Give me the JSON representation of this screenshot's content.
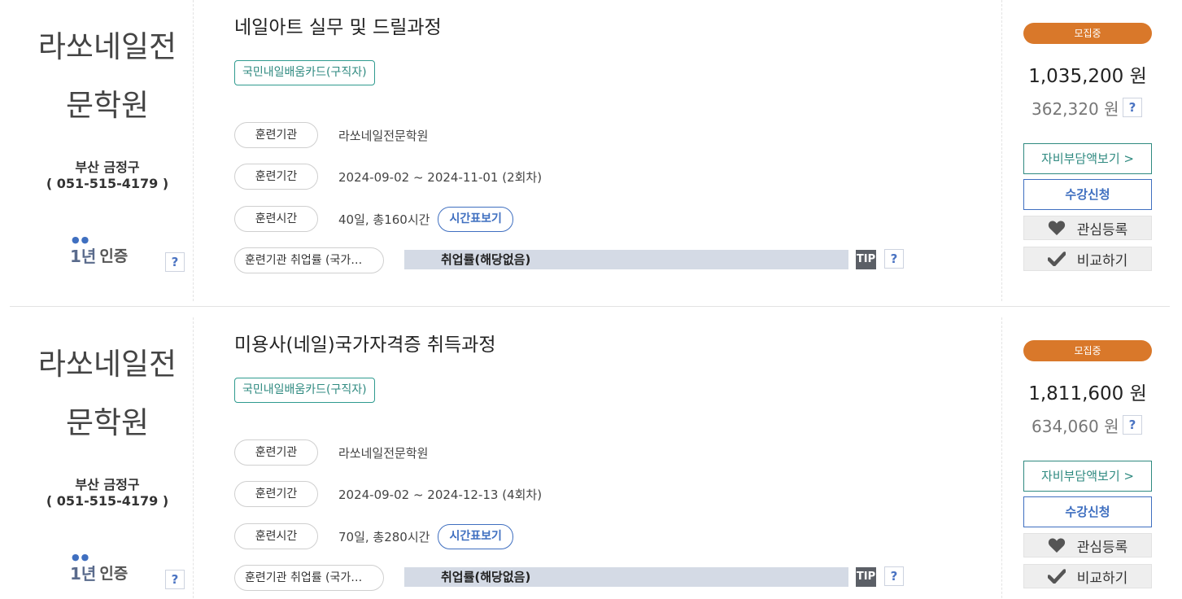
{
  "courses": [
    {
      "institution_name_line1": "라쏘네일전",
      "institution_name_line2": "문학원",
      "location": "부산 금정구",
      "phone": "( 051-515-4179 )",
      "cert_number": "1년",
      "cert_label": "인증",
      "cert_help": "?",
      "title": "네일아트 실무 및 드릴과정",
      "card_tag": "국민내일배움카드(구직자)",
      "institution_label": "훈련기관",
      "institution_value": "라쏘네일전문학원",
      "period_label": "훈련기간",
      "period_value": "2024-09-02 ~ 2024-11-01 (2회차)",
      "hours_label": "훈련시간",
      "hours_value": "40일, 총160시간",
      "timetable_button": "시간표보기",
      "employment_label": "훈련기관 취업률 (국가…",
      "employment_value": "취업률(해당없음)",
      "tip_label": "TIP",
      "employment_help": "?",
      "status": "모집중",
      "price": "1,035,200 원",
      "self_pay": "362,320 원",
      "self_pay_help": "?",
      "self_pay_button": "자비부담액보기 >",
      "apply_button": "수강신청",
      "favorite_button": "관심등록",
      "compare_button": "비교하기"
    },
    {
      "institution_name_line1": "라쏘네일전",
      "institution_name_line2": "문학원",
      "location": "부산 금정구",
      "phone": "( 051-515-4179 )",
      "cert_number": "1년",
      "cert_label": "인증",
      "cert_help": "?",
      "title": "미용사(네일)국가자격증 취득과정",
      "card_tag": "국민내일배움카드(구직자)",
      "institution_label": "훈련기관",
      "institution_value": "라쏘네일전문학원",
      "period_label": "훈련기간",
      "period_value": "2024-09-02 ~ 2024-12-13 (4회차)",
      "hours_label": "훈련시간",
      "hours_value": "70일, 총280시간",
      "timetable_button": "시간표보기",
      "employment_label": "훈련기관 취업률 (국가…",
      "employment_value": "취업률(해당없음)",
      "tip_label": "TIP",
      "employment_help": "?",
      "status": "모집중",
      "price": "1,811,600 원",
      "self_pay": "634,060 원",
      "self_pay_help": "?",
      "self_pay_button": "자비부담액보기 >",
      "apply_button": "수강신청",
      "favorite_button": "관심등록",
      "compare_button": "비교하기"
    }
  ],
  "icons": {
    "cert_dots": "certification-dots-icon",
    "favorite": "heart-icon",
    "compare": "checkmark-icon"
  },
  "colors": {
    "status_badge": "#d9782a",
    "teal_accent": "#2f8a80",
    "blue_accent": "#3f6fc0",
    "employment_bar": "#d4dae5",
    "tip_badge": "#5b5f66"
  }
}
